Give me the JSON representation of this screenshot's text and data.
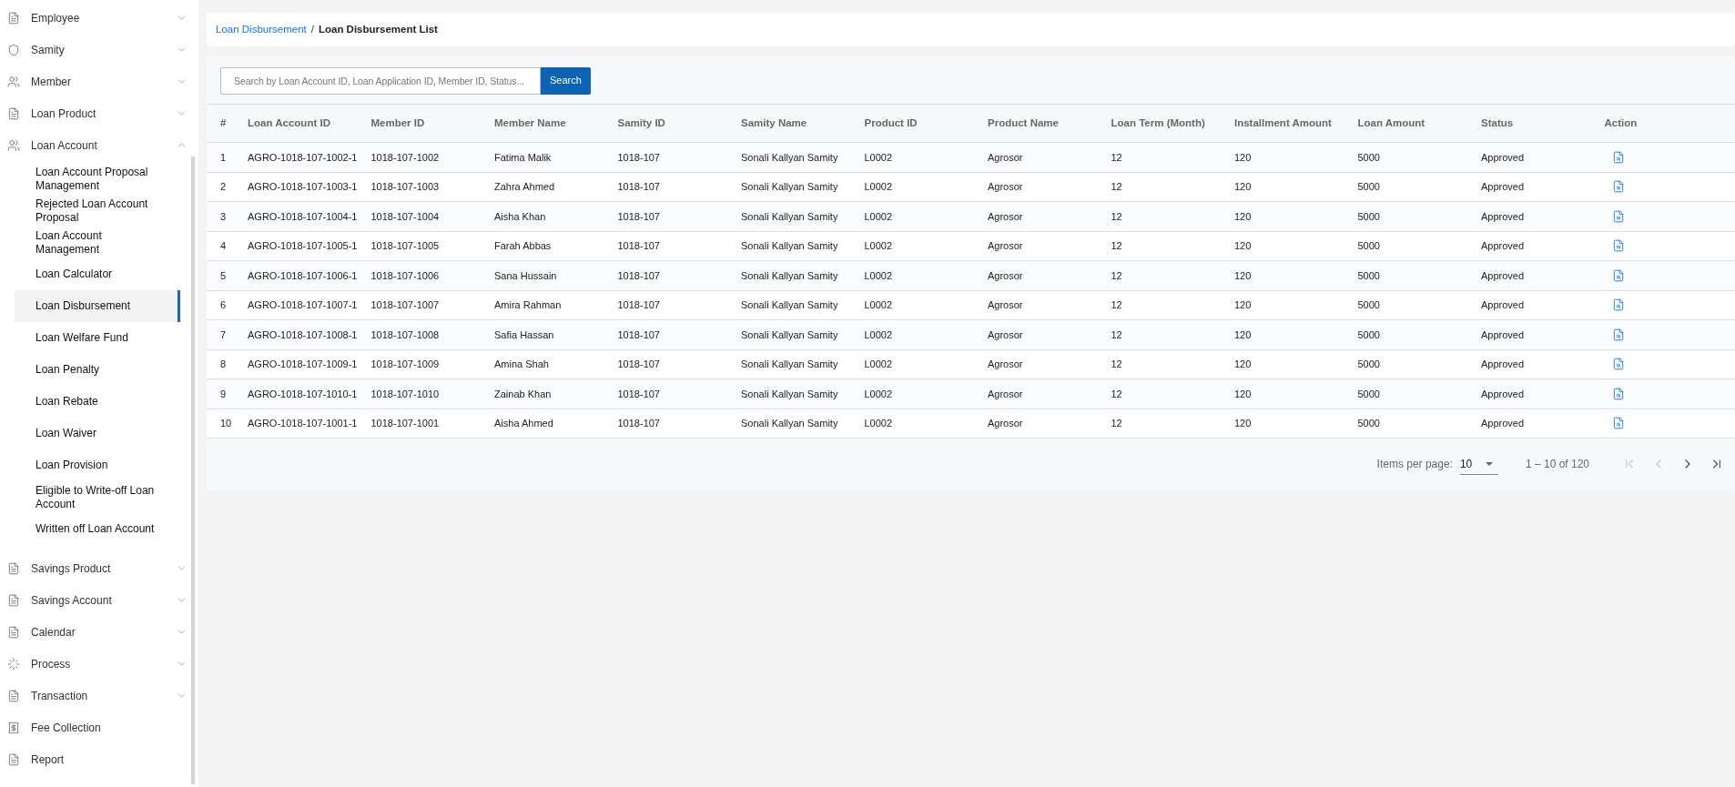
{
  "sidebar": {
    "items": [
      {
        "label": "Employee",
        "expanded": false
      },
      {
        "label": "Samity",
        "expanded": false
      },
      {
        "label": "Member",
        "expanded": false
      },
      {
        "label": "Loan Product",
        "expanded": false
      },
      {
        "label": "Loan Account",
        "expanded": true,
        "children": [
          {
            "label": "Loan Account Proposal Management",
            "selected": false
          },
          {
            "label": "Rejected Loan Account Proposal",
            "selected": false
          },
          {
            "label": "Loan Account Management",
            "selected": false
          },
          {
            "label": "Loan Calculator",
            "selected": false
          },
          {
            "label": "Loan Disbursement",
            "selected": true
          },
          {
            "label": "Loan Welfare Fund",
            "selected": false
          },
          {
            "label": "Loan Penalty",
            "selected": false
          },
          {
            "label": "Loan Rebate",
            "selected": false
          },
          {
            "label": "Loan Waiver",
            "selected": false
          },
          {
            "label": "Loan Provision",
            "selected": false
          },
          {
            "label": "Eligible to Write-off Loan Account",
            "selected": false
          },
          {
            "label": "Written off Loan Account",
            "selected": false
          }
        ]
      },
      {
        "label": "Savings Product",
        "expanded": false
      },
      {
        "label": "Savings Account",
        "expanded": false
      },
      {
        "label": "Calendar",
        "expanded": false
      },
      {
        "label": "Process",
        "expanded": false
      },
      {
        "label": "Transaction",
        "expanded": false
      },
      {
        "label": "Fee Collection"
      },
      {
        "label": "Report"
      }
    ]
  },
  "breadcrumb": {
    "separator": "/",
    "items": [
      "Loan Disbursement",
      "Loan Disbursement List"
    ]
  },
  "search": {
    "placeholder": "Search by Loan Account ID, Loan Application ID, Member ID, Status...",
    "button": "Search"
  },
  "table": {
    "columns": [
      "#",
      "Loan Account ID",
      "Member ID",
      "Member Name",
      "Samity ID",
      "Samity Name",
      "Product ID",
      "Product Name",
      "Loan Term (Month)",
      "Installment Amount",
      "Loan Amount",
      "Status",
      "Action"
    ],
    "rows": [
      [
        "1",
        "AGRO-1018-107-1002-1",
        "1018-107-1002",
        "Fatima Malik",
        "1018-107",
        "Sonali Kallyan Samity",
        "L0002",
        "Agrosor",
        "12",
        "120",
        "5000",
        "Approved"
      ],
      [
        "2",
        "AGRO-1018-107-1003-1",
        "1018-107-1003",
        "Zahra Ahmed",
        "1018-107",
        "Sonali Kallyan Samity",
        "L0002",
        "Agrosor",
        "12",
        "120",
        "5000",
        "Approved"
      ],
      [
        "3",
        "AGRO-1018-107-1004-1",
        "1018-107-1004",
        "Aisha Khan",
        "1018-107",
        "Sonali Kallyan Samity",
        "L0002",
        "Agrosor",
        "12",
        "120",
        "5000",
        "Approved"
      ],
      [
        "4",
        "AGRO-1018-107-1005-1",
        "1018-107-1005",
        "Farah Abbas",
        "1018-107",
        "Sonali Kallyan Samity",
        "L0002",
        "Agrosor",
        "12",
        "120",
        "5000",
        "Approved"
      ],
      [
        "5",
        "AGRO-1018-107-1006-1",
        "1018-107-1006",
        "Sana Hussain",
        "1018-107",
        "Sonali Kallyan Samity",
        "L0002",
        "Agrosor",
        "12",
        "120",
        "5000",
        "Approved"
      ],
      [
        "6",
        "AGRO-1018-107-1007-1",
        "1018-107-1007",
        "Amira Rahman",
        "1018-107",
        "Sonali Kallyan Samity",
        "L0002",
        "Agrosor",
        "12",
        "120",
        "5000",
        "Approved"
      ],
      [
        "7",
        "AGRO-1018-107-1008-1",
        "1018-107-1008",
        "Safia Hassan",
        "1018-107",
        "Sonali Kallyan Samity",
        "L0002",
        "Agrosor",
        "12",
        "120",
        "5000",
        "Approved"
      ],
      [
        "8",
        "AGRO-1018-107-1009-1",
        "1018-107-1009",
        "Amina Shah",
        "1018-107",
        "Sonali Kallyan Samity",
        "L0002",
        "Agrosor",
        "12",
        "120",
        "5000",
        "Approved"
      ],
      [
        "9",
        "AGRO-1018-107-1010-1",
        "1018-107-1010",
        "Zainab Khan",
        "1018-107",
        "Sonali Kallyan Samity",
        "L0002",
        "Agrosor",
        "12",
        "120",
        "5000",
        "Approved"
      ],
      [
        "10",
        "AGRO-1018-107-1001-1",
        "1018-107-1001",
        "Aisha Ahmed",
        "1018-107",
        "Sonali Kallyan Samity",
        "L0002",
        "Agrosor",
        "12",
        "120",
        "5000",
        "Approved"
      ]
    ]
  },
  "paginator": {
    "label": "Items per page:",
    "page_size": "10",
    "range": "1 – 10 of 120",
    "first_disabled": true,
    "prev_disabled": true,
    "next_disabled": false,
    "last_disabled": false
  }
}
